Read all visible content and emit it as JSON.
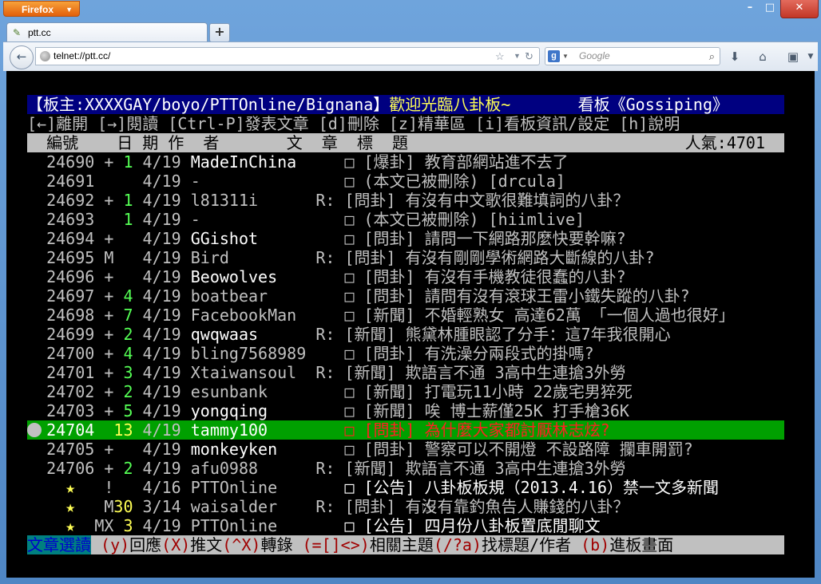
{
  "browser": {
    "app_button": "Firefox",
    "tab_title": "ptt.cc",
    "url": "telnet://ptt.cc/",
    "search_placeholder": "Google"
  },
  "term": {
    "header_left": "【板主:XXXXGAY/boyo/PTTOnline/Bignana】",
    "header_mid": "歡迎光臨八卦板~",
    "header_right": "看板《Gossiping》",
    "help": "[←]離開 [→]閱讀 [Ctrl-P]發表文章 [d]刪除 [z]精華區 [i]看板資訊/設定 [h]說明",
    "col_header": "  編號    日 期 作  者       文  章  標  題",
    "popularity": "人氣:4701",
    "rows": [
      {
        "num": "24690",
        "mark": " +",
        "cnt": " 1",
        "date": "4/19",
        "author": "MadeInChina",
        "re": "  ",
        "title": "□ [爆卦] 教育部網站進不去了"
      },
      {
        "num": "24691",
        "mark": "  ",
        "cnt": "  ",
        "date": "4/19",
        "author": "-",
        "re": "  ",
        "title": "□ (本文已被刪除) [drcula]"
      },
      {
        "num": "24692",
        "mark": " +",
        "cnt": " 1",
        "date": "4/19",
        "author": "l81311i",
        "re": "R:",
        "title": "[問卦] 有沒有中文歌很難填詞的八卦？"
      },
      {
        "num": "24693",
        "mark": "  ",
        "cnt": " 1",
        "date": "4/19",
        "author": "-",
        "re": "  ",
        "title": "□ (本文已被刪除) [hiimlive]"
      },
      {
        "num": "24694",
        "mark": " +",
        "cnt": "  ",
        "date": "4/19",
        "author": "GGishot",
        "re": "  ",
        "title": "□ [問卦] 請問一下網路那麼快要幹嘛?"
      },
      {
        "num": "24695",
        "mark": " M",
        "cnt": "  ",
        "date": "4/19",
        "author": "Bird",
        "re": "R:",
        "title": "[問卦] 有沒有剛剛學術網路大斷線的八卦?"
      },
      {
        "num": "24696",
        "mark": " +",
        "cnt": "  ",
        "date": "4/19",
        "author": "Beowolves",
        "re": "  ",
        "title": "□ [問卦] 有沒有手機教徒很蠢的八卦?"
      },
      {
        "num": "24697",
        "mark": " +",
        "cnt": " 4",
        "date": "4/19",
        "author": "boatbear",
        "re": "  ",
        "title": "□ [問卦] 請問有沒有滾球王雷小鐵失蹤的八卦?"
      },
      {
        "num": "24698",
        "mark": " +",
        "cnt": " 7",
        "date": "4/19",
        "author": "FacebookMan",
        "re": "  ",
        "title": "□ [新聞] 不婚輕熟女 高達62萬 「一個人過也很好」"
      },
      {
        "num": "24699",
        "mark": " +",
        "cnt": " 2",
        "date": "4/19",
        "author": "qwqwaas",
        "re": "R:",
        "title": "[新聞] 熊黛林腫眼認了分手：這7年我很開心"
      },
      {
        "num": "24700",
        "mark": " +",
        "cnt": " 4",
        "date": "4/19",
        "author": "bling7568989",
        "re": "  ",
        "title": "□ [問卦] 有洗澡分兩段式的掛嗎?"
      },
      {
        "num": "24701",
        "mark": " +",
        "cnt": " 3",
        "date": "4/19",
        "author": "Xtaiwansoul",
        "re": "R:",
        "title": "[新聞] 欺語言不通 3高中生連搶3外勞"
      },
      {
        "num": "24702",
        "mark": " +",
        "cnt": " 2",
        "date": "4/19",
        "author": "esunbank",
        "re": "  ",
        "title": "□ [新聞] 打電玩11小時 22歲宅男猝死"
      },
      {
        "num": "24703",
        "mark": " +",
        "cnt": " 5",
        "date": "4/19",
        "author": "yongqing",
        "re": "  ",
        "title": "□ [新聞] 唉 博士薪僅25K 打手槍36K"
      },
      {
        "num": "24704",
        "mark": "  ",
        "cnt": "13",
        "date": "4/19",
        "author": "tammy100",
        "re": "  ",
        "title": "□ [問卦] 為什麼大家都討厭林志炫?"
      },
      {
        "num": "24705",
        "mark": " +",
        "cnt": "  ",
        "date": "4/19",
        "author": "monkeyken",
        "re": "  ",
        "title": "□ [問卦] 警察可以不開燈 不設路障 攔車開罰?"
      },
      {
        "num": "24706",
        "mark": " +",
        "cnt": " 2",
        "date": "4/19",
        "author": "afu0988",
        "re": "R:",
        "title": "[新聞] 欺語言不通 3高中生連搶3外勞"
      },
      {
        "num": "★",
        "mark": " !",
        "cnt": "  ",
        "date": "4/16",
        "author": "PTTOnline",
        "re": "  ",
        "title": "□ [公告] 八卦板板規（2013.4.16）禁一文多新聞"
      },
      {
        "num": "★",
        "mark": " M",
        "cnt": "30",
        "date": "3/14",
        "author": "waisalder",
        "re": "R:",
        "title": "[問卦] 有沒有靠釣魚告人賺錢的八卦？"
      },
      {
        "num": "★",
        "mark": "MX",
        "cnt": "3",
        "date": "4/19",
        "author": "PTTOnline",
        "re": "  ",
        "title": "□ [公告] 四月份八卦板置底閒聊文"
      }
    ],
    "footer_label": "文章選讀",
    "footer_items": [
      {
        "key": " (y)",
        "text": "回應"
      },
      {
        "key": "(X)",
        "text": "推文"
      },
      {
        "key": "(^X)",
        "text": "轉錄 "
      },
      {
        "key": "(=[]<>)",
        "text": "相關主題"
      },
      {
        "key": "(/?a)",
        "text": "找標題/作者 "
      },
      {
        "key": "(b)",
        "text": "進板畫面"
      }
    ]
  }
}
